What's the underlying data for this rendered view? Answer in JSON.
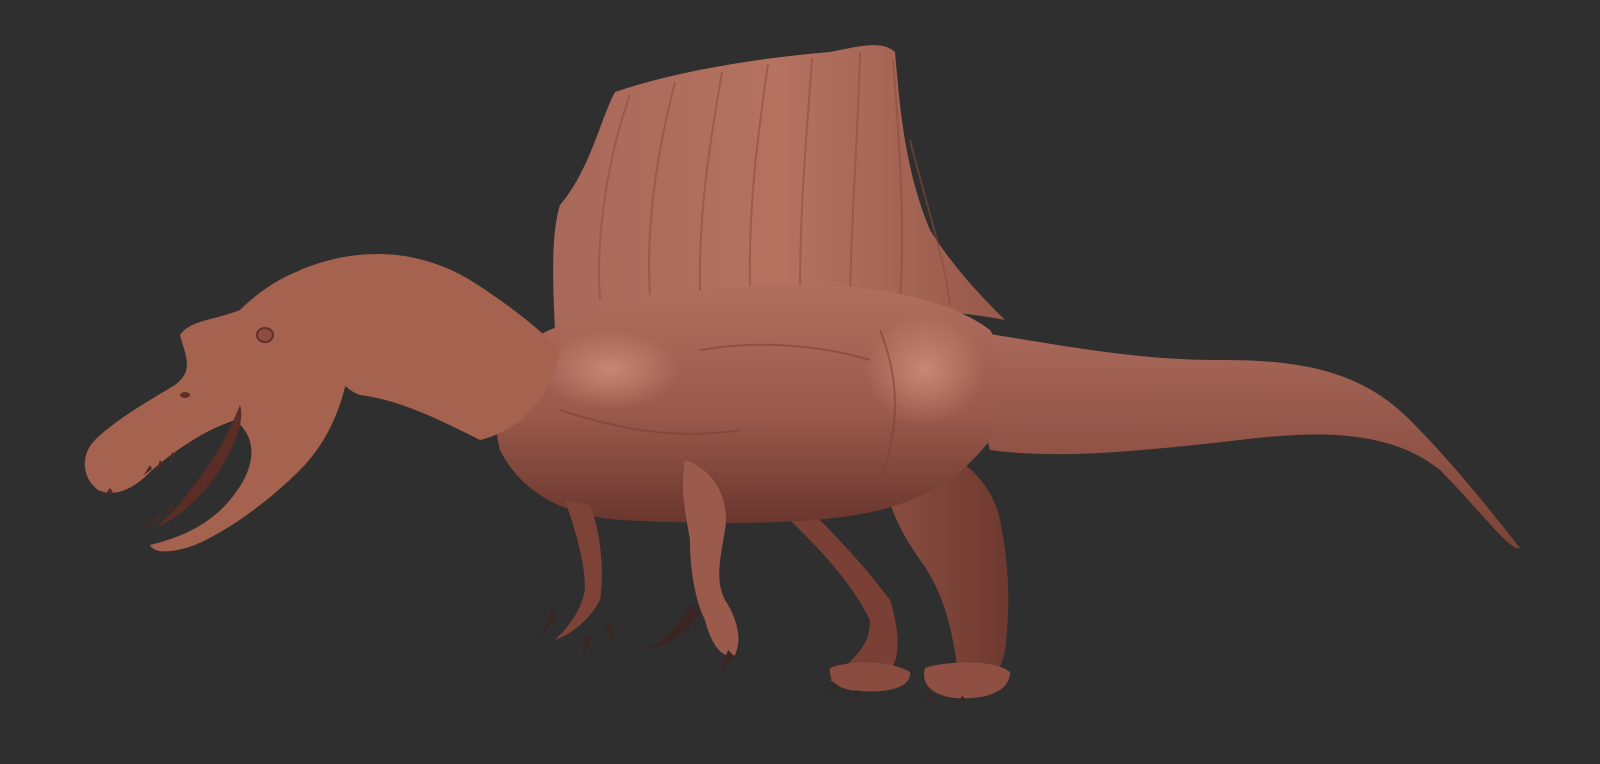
{
  "scene": {
    "subject_icon": "spinosaurus-sculpt",
    "colors": {
      "background": "#2f2f2f",
      "clay_base": "#9a5a4c",
      "clay_light": "#bf7c6b",
      "clay_dark": "#5e3029",
      "claw": "#3a2522"
    }
  }
}
